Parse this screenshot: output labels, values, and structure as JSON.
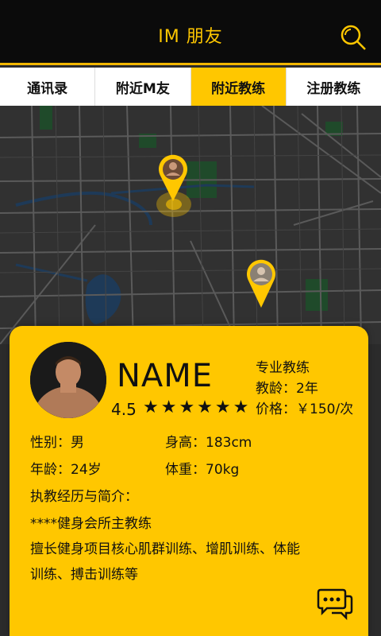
{
  "header": {
    "title": "IM 朋友"
  },
  "tabs": [
    {
      "label": "通讯录",
      "active": false
    },
    {
      "label": "附近M友",
      "active": false
    },
    {
      "label": "附近教练",
      "active": true
    },
    {
      "label": "注册教练",
      "active": false
    }
  ],
  "profile": {
    "name": "NAME",
    "rating": "4.5",
    "stars_shown": 6,
    "title": "专业教练",
    "experience": "教龄：2年",
    "price": "价格：￥150/次",
    "gender": "性别：男",
    "height": "身高：183cm",
    "age": "年龄：24岁",
    "weight": "体重：70kg",
    "bio_heading": "执教经历与简介：",
    "bio_line1": "****健身会所主教练",
    "bio_line2": "擅长健身项目核心肌群训练、增肌训练、体能",
    "bio_line3": "训练、搏击训练等"
  },
  "colors": {
    "accent": "#ffc700",
    "header_bg": "#0b0b0b",
    "map_bg": "#313131",
    "park": "#1f4a2a",
    "water": "#1e3a58"
  }
}
